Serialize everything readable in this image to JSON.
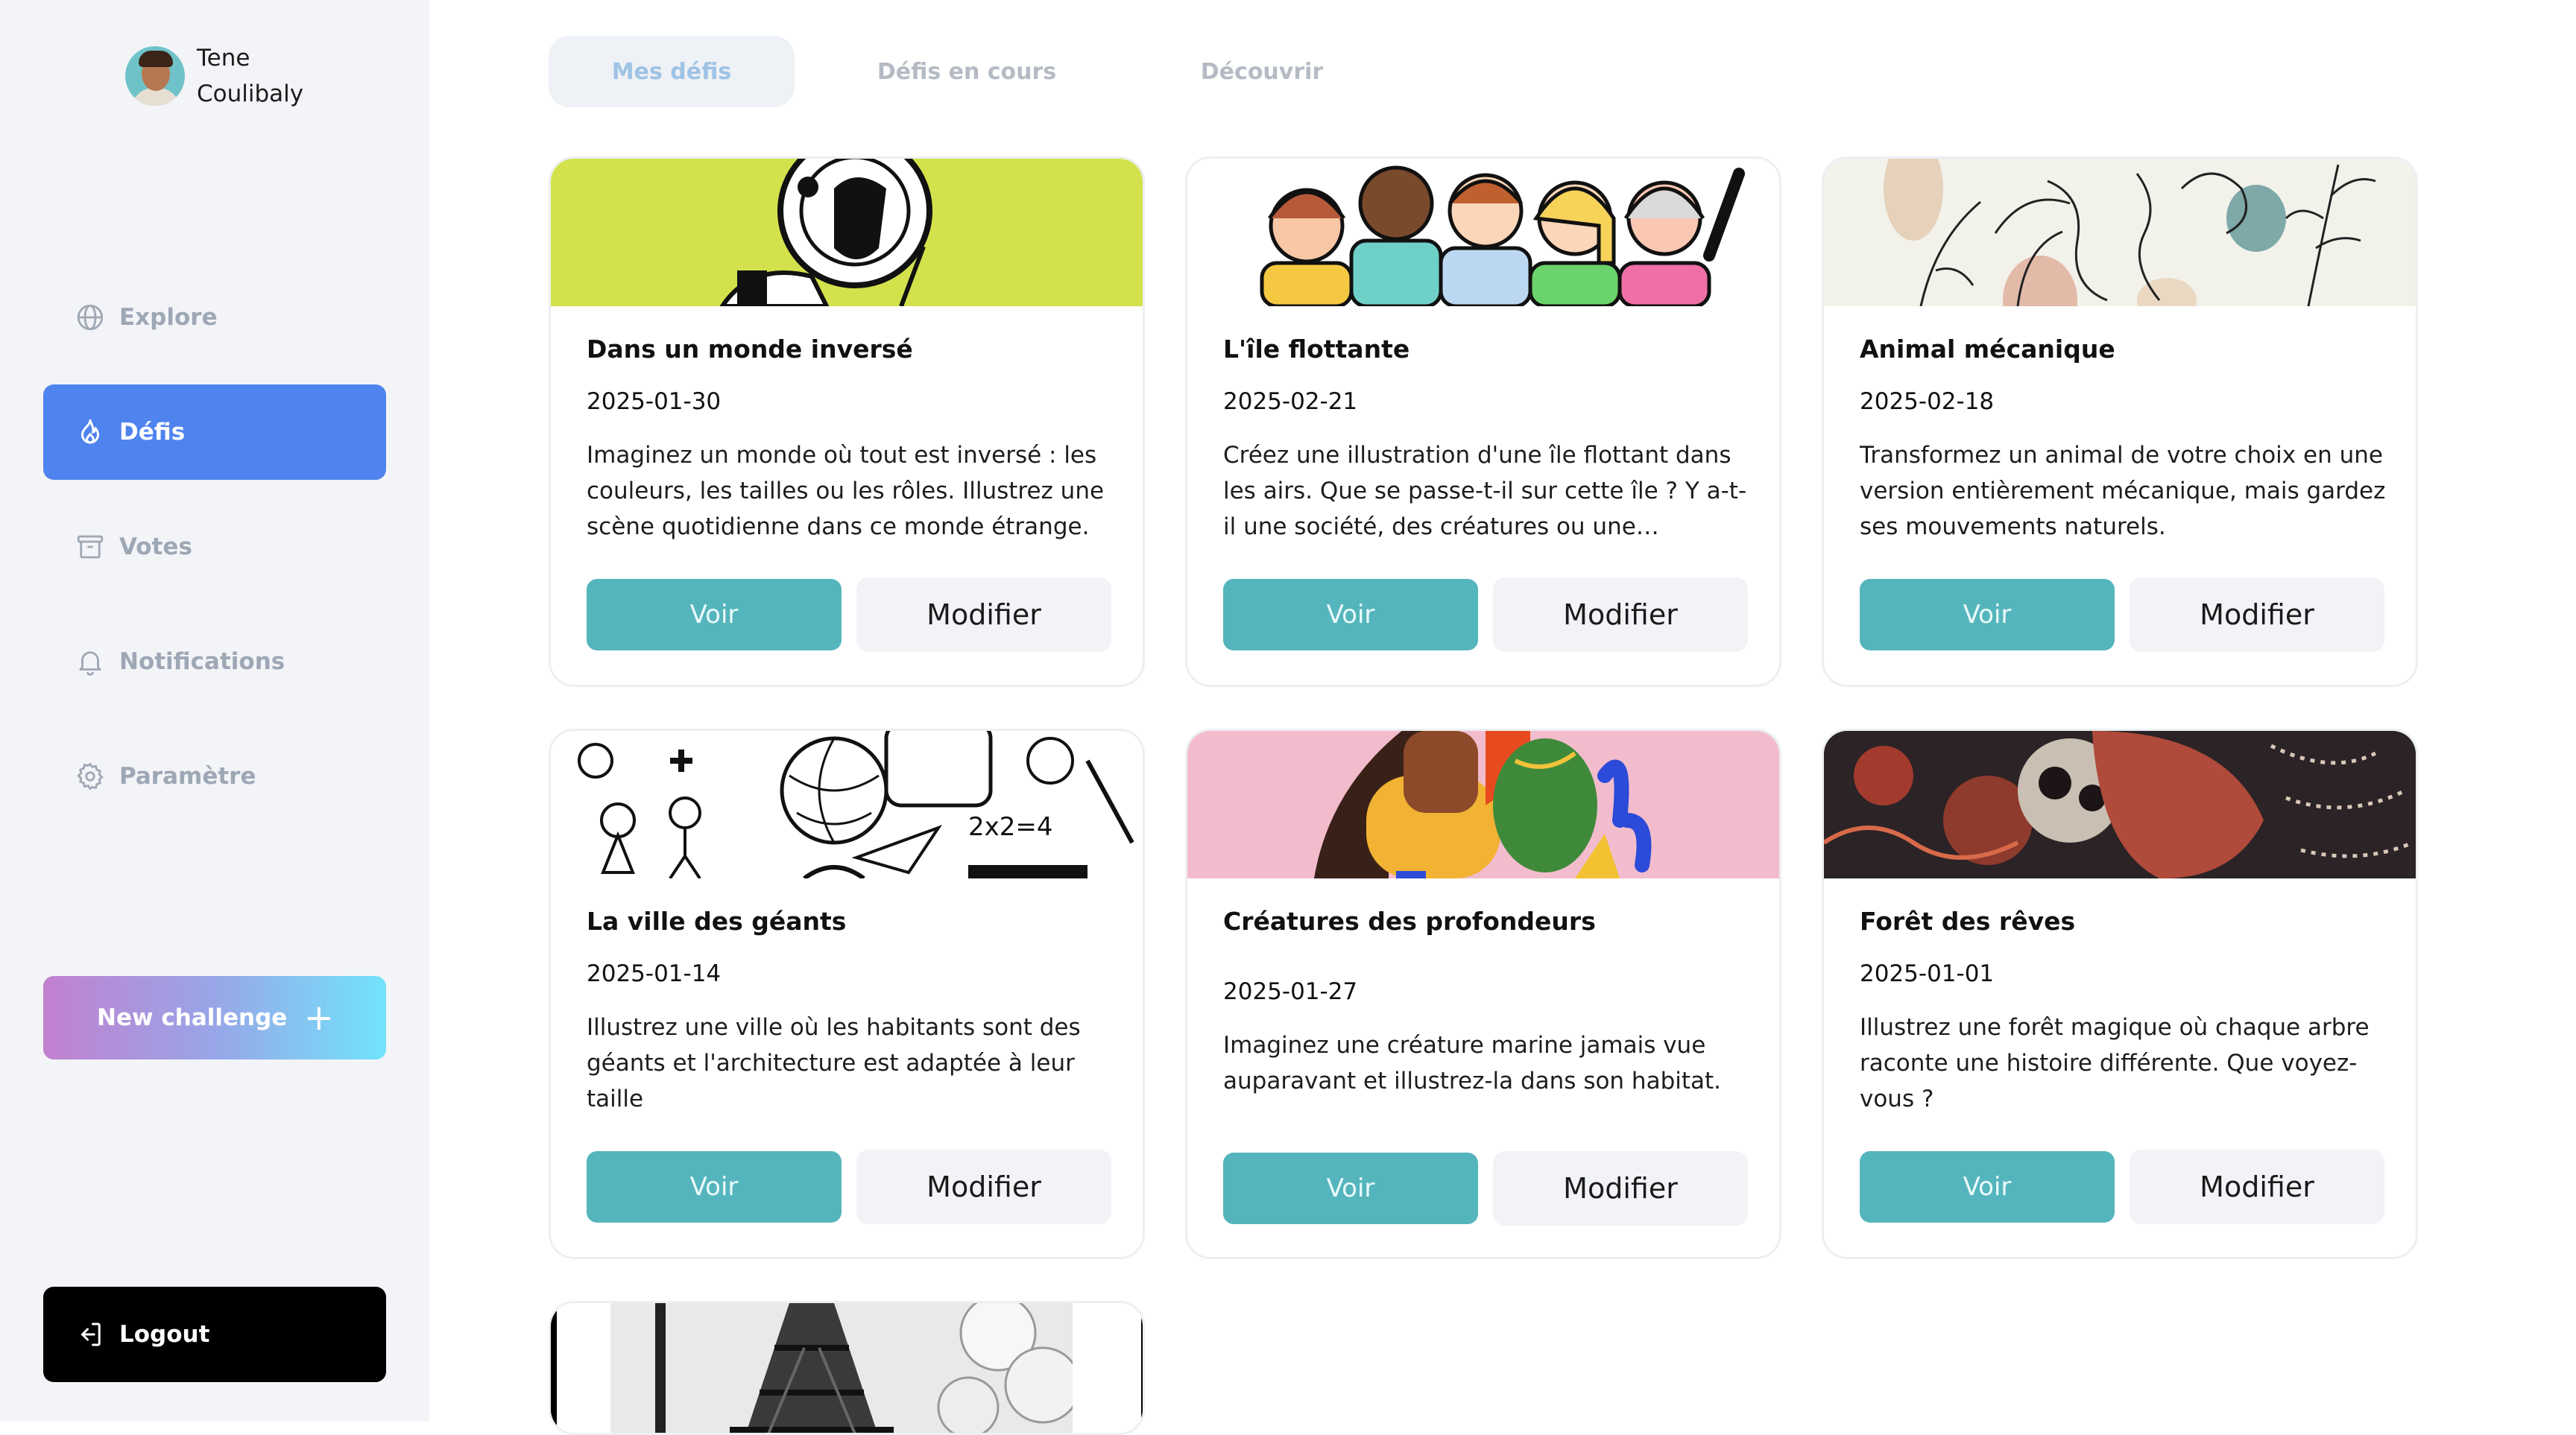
{
  "user": {
    "name": "Tene Coulibaly"
  },
  "sidebar": {
    "items": [
      {
        "label": "Explore",
        "icon": "globe-icon"
      },
      {
        "label": "Défis",
        "icon": "flame-icon",
        "active": true
      },
      {
        "label": "Votes",
        "icon": "archive-box-icon"
      },
      {
        "label": "Notifications",
        "icon": "bell-icon"
      },
      {
        "label": "Paramètre",
        "icon": "gear-icon"
      }
    ],
    "new_challenge_label": "New challenge",
    "new_challenge_icon": "plus-icon",
    "logout_label": "Logout",
    "logout_icon": "logout-icon"
  },
  "tabs": [
    {
      "label": "Mes défis",
      "active": true
    },
    {
      "label": "Défis en cours"
    },
    {
      "label": "Découvrir"
    }
  ],
  "cards": [
    {
      "title": "Dans un monde inversé",
      "date": "2025-01-30",
      "description": "Imaginez un monde où tout est inversé : les couleurs, les tailles ou les rôles. Illustrez une scène quotidienne dans ce monde étrange.",
      "view_label": "Voir",
      "edit_label": "Modifier"
    },
    {
      "title": "L'île flottante",
      "date": "2025-02-21",
      "description": "Créez une illustration d'une île flottant dans les airs. Que se passe-t-il sur cette île ? Y a-t-il une société, des créatures ou une ambiance...",
      "view_label": "Voir",
      "edit_label": "Modifier"
    },
    {
      "title": "Animal mécanique",
      "date": "2025-02-18",
      "description": "Transformez un animal de votre choix en une version entièrement mécanique, mais gardez ses mouvements naturels.",
      "view_label": "Voir",
      "edit_label": "Modifier"
    },
    {
      "title": "La ville des géants",
      "date": "2025-01-14",
      "description": "Illustrez une ville où les habitants sont des géants et l'architecture est adaptée à leur taille",
      "view_label": "Voir",
      "edit_label": "Modifier"
    },
    {
      "title": "Créatures des profondeurs",
      "date": "2025-01-27",
      "description": "Imaginez une créature marine jamais vue auparavant et illustrez-la dans son habitat.",
      "view_label": "Voir",
      "edit_label": "Modifier"
    },
    {
      "title": "Forêt des rêves",
      "date": "2025-01-01",
      "description": "Illustrez une forêt magique où chaque arbre raconte une histoire différente. Que voyez-vous ?",
      "view_label": "Voir",
      "edit_label": "Modifier"
    }
  ],
  "colors": {
    "accent": "#4f83ee",
    "button_primary": "#55b5bd",
    "button_secondary": "#f1f3f6",
    "sidebar_bg": "#f3f4f7"
  }
}
